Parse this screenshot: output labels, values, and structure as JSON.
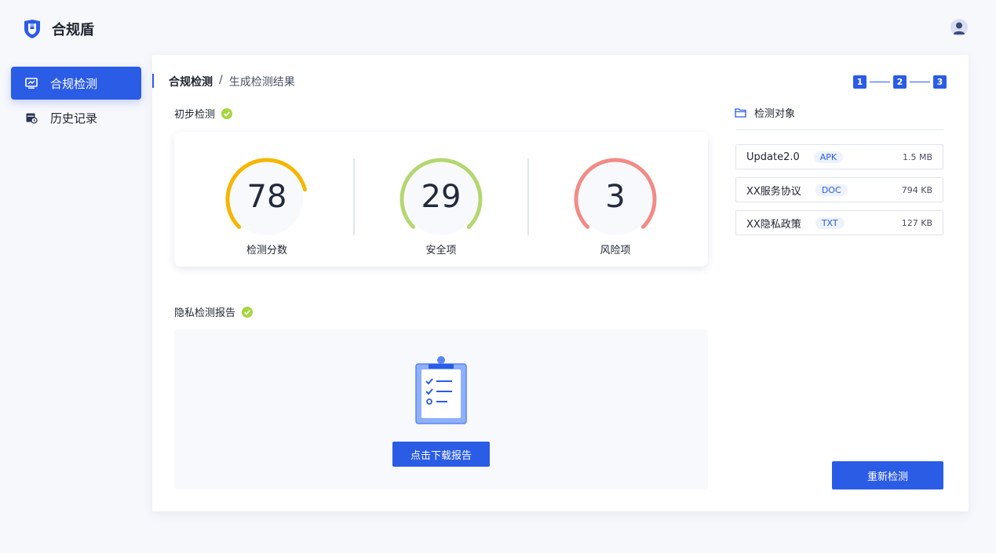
{
  "app": {
    "name": "合规盾"
  },
  "sidebar": {
    "items": [
      {
        "label": "合规检测",
        "icon": "monitor-chart-icon",
        "active": true
      },
      {
        "label": "历史记录",
        "icon": "calendar-clock-icon",
        "active": false
      }
    ]
  },
  "breadcrumb": {
    "root": "合规检测",
    "separator": "/",
    "current": "生成检测结果"
  },
  "steps": [
    "1",
    "2",
    "3"
  ],
  "initial_check": {
    "title": "初步检测",
    "gauges": [
      {
        "value": "78",
        "label": "检测分数",
        "color": "#f7b500",
        "fraction": 0.78
      },
      {
        "value": "29",
        "label": "安全项",
        "color": "#b3d771",
        "fraction": 1.0
      },
      {
        "value": "3",
        "label": "风险项",
        "color": "#f28b86",
        "fraction": 1.0
      }
    ]
  },
  "privacy_report": {
    "title": "隐私检测报告",
    "download_label": "点击下载报告"
  },
  "targets": {
    "title": "检测对象",
    "items": [
      {
        "name": "Update2.0",
        "type": "APK",
        "size": "1.5 MB"
      },
      {
        "name": "XX服务协议",
        "type": "DOC",
        "size": "794 KB"
      },
      {
        "name": "XX隐私政策",
        "type": "TXT",
        "size": "127 KB"
      }
    ]
  },
  "actions": {
    "redetect_label": "重新检测"
  },
  "colors": {
    "primary": "#2b5ce6",
    "success": "#a6d63f"
  }
}
